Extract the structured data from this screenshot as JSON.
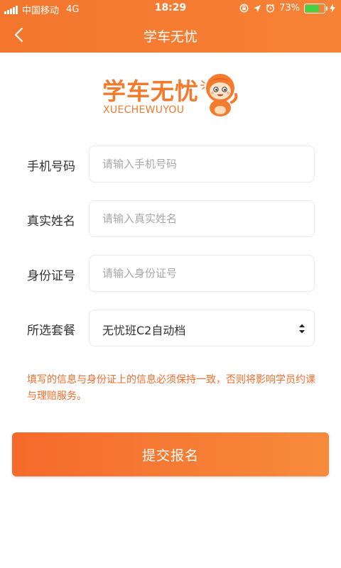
{
  "status_bar": {
    "carrier": "中国移动",
    "network": "4G",
    "time": "18:29",
    "battery": "73%",
    "battery_level": 0.73,
    "icons": [
      "signal-icon",
      "lock-rotation-icon",
      "location-icon",
      "alarm-icon",
      "battery-icon",
      "charging-icon"
    ]
  },
  "nav": {
    "title": "学车无忧",
    "back_icon": "chevron-left-icon"
  },
  "logo": {
    "name_cn": "学车无忧",
    "name_en": "XUECHEWUYOU"
  },
  "form": {
    "phone": {
      "label": "手机号码",
      "placeholder": "请输入手机号码",
      "value": ""
    },
    "name": {
      "label": "真实姓名",
      "placeholder": "请输入真实姓名",
      "value": ""
    },
    "id_card": {
      "label": "身份证号",
      "placeholder": "请输入身份证号",
      "value": ""
    },
    "package": {
      "label": "所选套餐",
      "value": "无忧班C2自动档"
    }
  },
  "notice": "填写的信息与身份证上的信息必须保持一致，否则将影响学员约课与理赔服务。",
  "submit_label": "提交报名",
  "colors": {
    "brand_orange": "#f4762e",
    "notice_text": "#f36c2c",
    "battery_fill": "#3fd34a"
  }
}
